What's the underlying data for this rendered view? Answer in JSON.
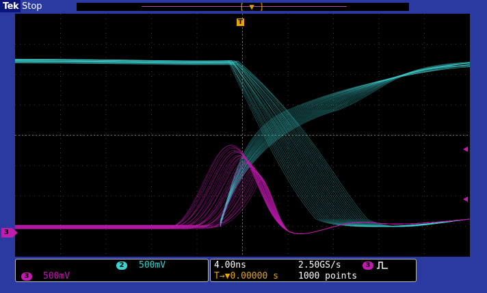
{
  "status": {
    "brand": "Tek",
    "mode": "Stop"
  },
  "screen": {
    "trigger_label": "T",
    "left_channel_marker": "3"
  },
  "ch2": {
    "badge": "2",
    "scale": "500mV",
    "color": "#3fd0d0"
  },
  "ch3": {
    "badge": "3",
    "scale": "500mV",
    "color": "#c21bb0"
  },
  "timebase": {
    "time_per_div": "4.00ns",
    "trigger_pos": "T→▼0.00000 s"
  },
  "acquisition": {
    "sample_rate": "2.50GS/s",
    "record_length": "1000 points",
    "trigger_source_badge": "3",
    "trigger_icon": "rising-pulse-icon"
  }
}
